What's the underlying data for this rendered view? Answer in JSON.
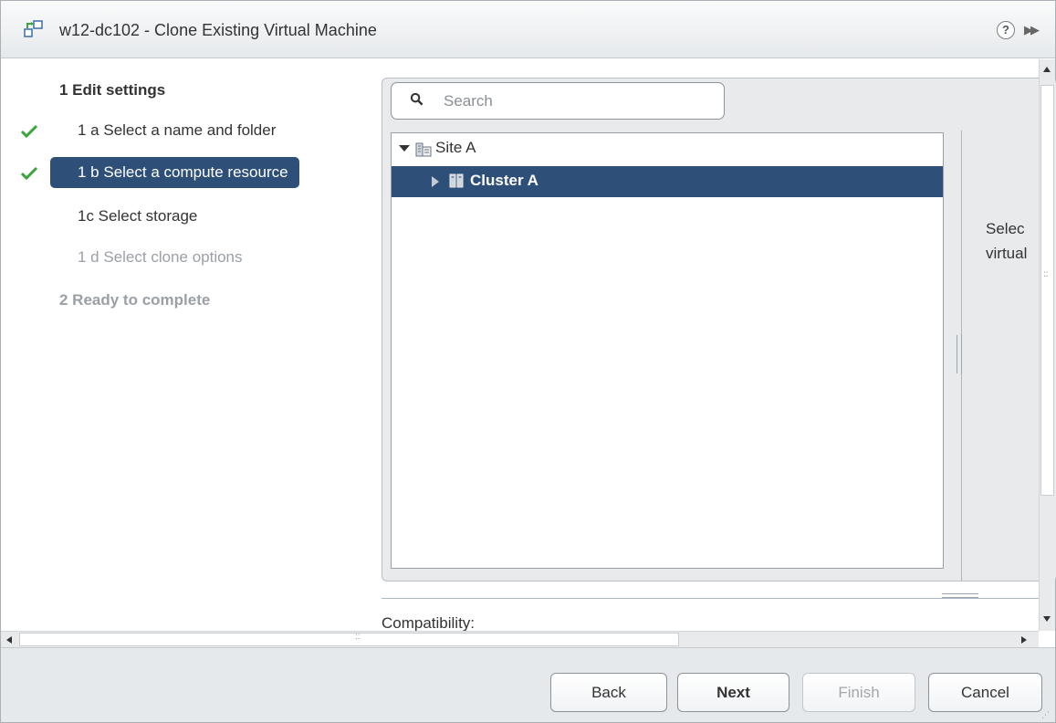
{
  "window": {
    "title": "w12-dc102 - Clone Existing Virtual Machine",
    "title_icon": "clone-vm-icon",
    "help_glyph": "?",
    "expand_glyph": "▶▶"
  },
  "steps": [
    {
      "label": "1 Edit settings",
      "state": "header"
    },
    {
      "label": "1 a  Select a name and folder",
      "state": "completed"
    },
    {
      "label": "1 b  Select a compute resource",
      "state": "current"
    },
    {
      "label": "1c  Select storage",
      "state": "pending"
    },
    {
      "label": "1 d  Select clone options",
      "state": "disabled"
    },
    {
      "label": "2  Ready to complete",
      "state": "disabled-header"
    }
  ],
  "search": {
    "placeholder": "Search",
    "value": ""
  },
  "tree": {
    "nodes": [
      {
        "label": "Site A",
        "icon": "datacenter-icon",
        "expanded": true,
        "level": 0
      },
      {
        "label": "Cluster A",
        "icon": "cluster-icon",
        "expanded": false,
        "level": 1,
        "selected": true
      }
    ]
  },
  "details": {
    "line1": "Selec",
    "line2": "virtual"
  },
  "compatibility": {
    "label": "Compatibility:"
  },
  "buttons": {
    "back": "Back",
    "next": "Next",
    "finish": "Finish",
    "cancel": "Cancel"
  },
  "colors": {
    "selection": "#2d4f78",
    "check": "#3aa53a",
    "footer": "#e6e9ec"
  }
}
